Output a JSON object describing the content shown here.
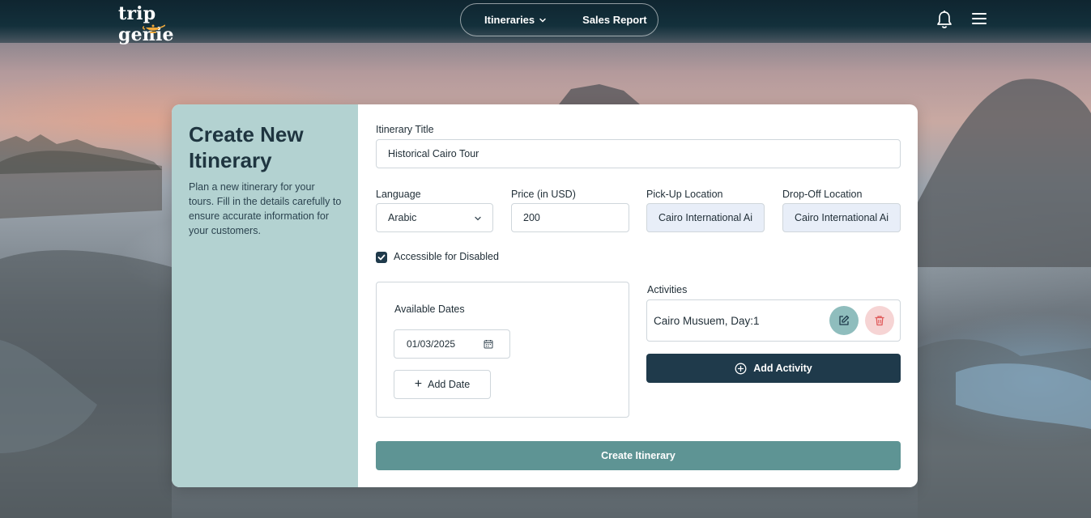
{
  "brand": {
    "logo_text": "trip genie"
  },
  "nav": {
    "items": [
      {
        "label": "Itineraries"
      },
      {
        "label": "Sales Report"
      }
    ]
  },
  "sidebar": {
    "title_line1": "Create New",
    "title_line2": "Itinerary",
    "description": "Plan a new itinerary for your tours. Fill in the details carefully to ensure accurate information for your customers."
  },
  "form": {
    "title_label": "Itinerary Title",
    "title_value": "Historical Cairo Tour",
    "language_label": "Language",
    "language_value": "Arabic",
    "price_label": "Price (in USD)",
    "price_value": "200",
    "pickup_label": "Pick-Up Location",
    "pickup_value": "Cairo International Ai",
    "dropoff_label": "Drop-Off Location",
    "dropoff_value": "Cairo International Ai",
    "accessible_label": "Accessible for Disabled",
    "accessible_checked": true,
    "dates_title": "Available Dates",
    "dates": [
      "01/03/2025"
    ],
    "add_date_label": "Add Date",
    "activities_label": "Activities",
    "activities": [
      "Cairo Musuem, Day:1"
    ],
    "add_activity_label": "Add Activity",
    "submit_label": "Create Itinerary"
  },
  "colors": {
    "topbar": "#0f2530",
    "sidebar_bg": "#b3d2d1",
    "primary_dark": "#1f3a4b",
    "submit_teal": "#5e9494",
    "edit_bg": "#8fbdbd",
    "delete_bg": "#f6d4d4",
    "delete_icon": "#e05a5a"
  }
}
